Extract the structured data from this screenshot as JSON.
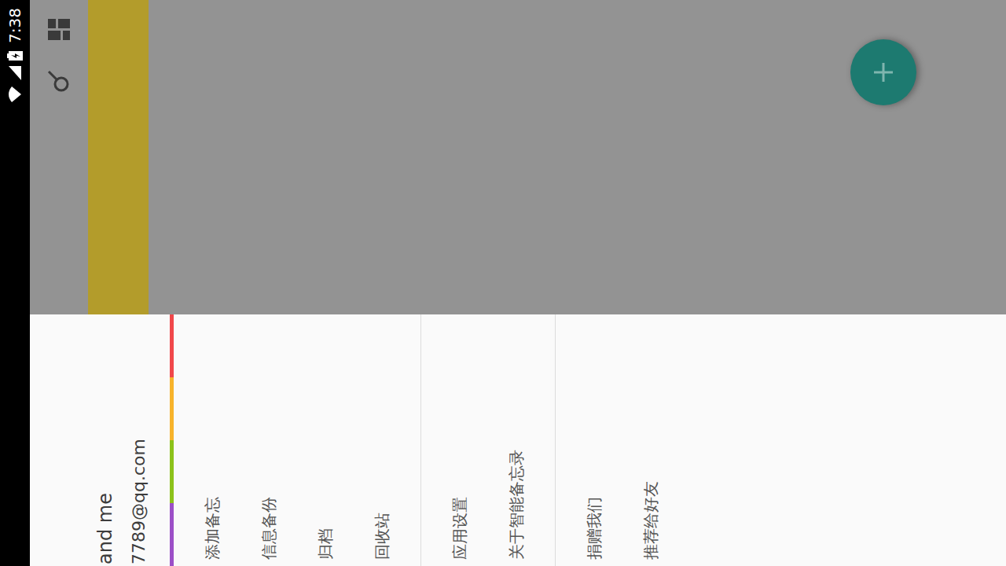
{
  "status_bar": {
    "time": "7:38"
  },
  "drawer": {
    "open": true,
    "account": {
      "name": "and me",
      "email": "7789@qq.com"
    },
    "color_strip": [
      {
        "color": "#9c4fc7"
      },
      {
        "color": "#8cc21a"
      },
      {
        "color": "#f7b32b"
      },
      {
        "color": "#f0474a"
      }
    ],
    "groups": [
      {
        "items": [
          {
            "label": "添加备忘"
          },
          {
            "label": "信息备份"
          },
          {
            "label": "归档"
          },
          {
            "label": "回收站"
          }
        ]
      },
      {
        "items": [
          {
            "label": "应用设置"
          },
          {
            "label": "关于智能备忘录"
          }
        ]
      },
      {
        "items": [
          {
            "label": "捐赠我们"
          },
          {
            "label": "推荐给好友"
          }
        ]
      }
    ]
  }
}
